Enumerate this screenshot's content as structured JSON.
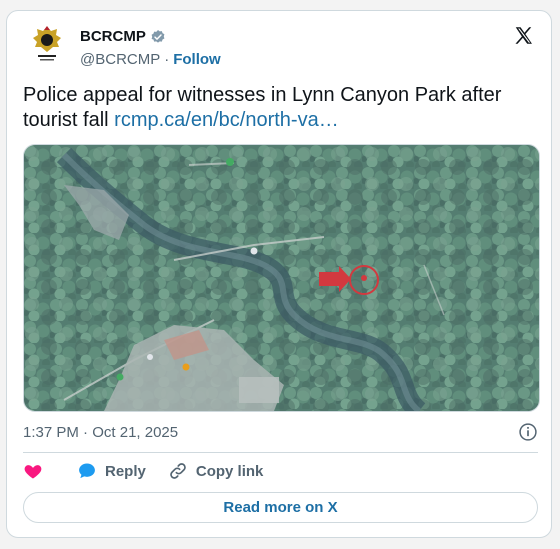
{
  "tweet": {
    "author_name": "BCRCMP",
    "handle": "@BCRCMP",
    "separator": "·",
    "follow_label": "Follow",
    "text": "Police appeal for witnesses in Lynn Canyon Park after tourist fall",
    "link_text": "rcmp.ca/en/bc/north-va…",
    "time": "1:37 PM",
    "date_separator": "·",
    "date": "Oct 21, 2025"
  },
  "actions": {
    "reply_label": "Reply",
    "copy_label": "Copy link"
  },
  "read_more_label": "Read more on X",
  "icons": {
    "avatar": "rcmp-crest-icon",
    "verified": "verified-badge-icon",
    "logo": "x-logo-icon",
    "info": "info-icon",
    "like": "heart-icon",
    "reply": "reply-bubble-icon",
    "copy": "link-icon"
  },
  "colors": {
    "link": "#1d6fa5",
    "heart": "#f91880",
    "reply": "#1d9bf0",
    "map_marker": "#d7262b"
  }
}
